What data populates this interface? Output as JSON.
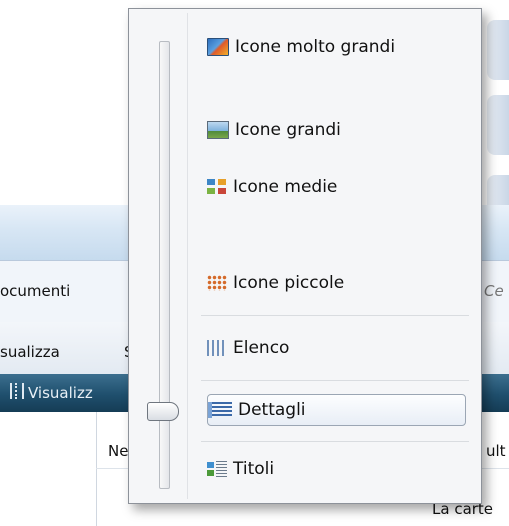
{
  "window": {
    "address_fragment": "ocumenti",
    "search_fragment": "Ce",
    "menu_bar": {
      "view_menu": "sualizza",
      "next_menu": "S"
    },
    "toolbar": {
      "views_button": "Visualizz"
    },
    "columns": {
      "name_fragment": "Ne",
      "date_fragment": "ult"
    },
    "file_fragment": "La carte"
  },
  "view_menu": {
    "slider": {
      "selected_step": "Dettagli"
    },
    "items": [
      {
        "label": "Icone molto grandi",
        "icon": "extra-large-icons-icon"
      },
      {
        "label": "Icone grandi",
        "icon": "large-icons-icon"
      },
      {
        "label": "Icone medie",
        "icon": "medium-icons-icon"
      },
      {
        "label": "Icone piccole",
        "icon": "small-icons-icon"
      },
      {
        "label": "Elenco",
        "icon": "list-icon"
      },
      {
        "label": "Dettagli",
        "icon": "details-icon",
        "selected": true
      },
      {
        "label": "Titoli",
        "icon": "tiles-icon"
      }
    ]
  },
  "colors": {
    "toolbar": "#1f4f6d",
    "menu_background": "#f5f6f8",
    "selection_border": "#9ba6b4"
  }
}
